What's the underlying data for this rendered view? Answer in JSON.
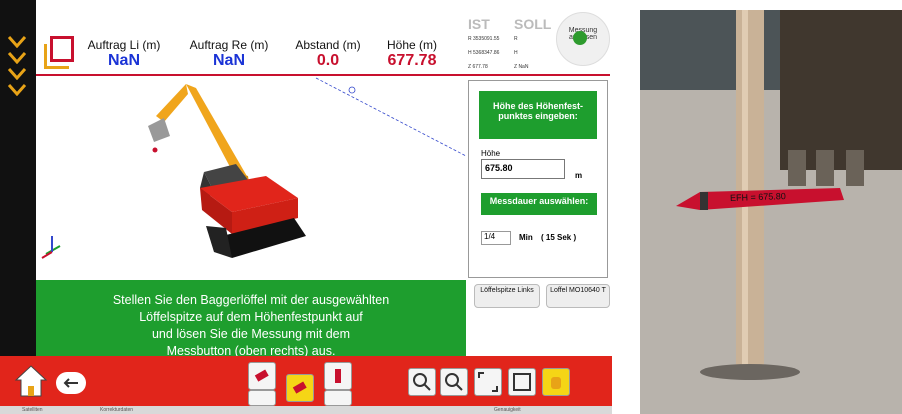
{
  "header": {
    "cols": [
      {
        "label": "Auftrag Li (m)",
        "value": "NaN",
        "color": "#1a33d6"
      },
      {
        "label": "Auftrag Re (m)",
        "value": "NaN",
        "color": "#1a33d6"
      },
      {
        "label": "Abstand (m)",
        "value": "0.0",
        "color": "#c8102e"
      },
      {
        "label": "Höhe (m)",
        "value": "677.78",
        "color": "#c8102e"
      }
    ],
    "ist": "IST",
    "soll": "SOLL",
    "coords": [
      "R 3535091.55",
      "H 5368347.86",
      "Z 677.78"
    ],
    "soll_vals": [
      "R",
      "H",
      "Z NaN"
    ],
    "measure_button": "Messung auslösen"
  },
  "panel": {
    "height_title": "Höhe des Höhenfest-punktes eingeben:",
    "height_label": "Höhe",
    "height_value": "675.80",
    "height_unit": "m",
    "duration_title": "Messdauer auswählen:",
    "duration_value": "1/4",
    "duration_unit": "Min",
    "duration_secs": "( 15 Sek )",
    "spoon_tip_btn": "Löffelspitze Links",
    "spoon_btn": "Loffel MO10640 T"
  },
  "message": [
    "Stellen Sie den Baggerlöffel mit der ausgewählten",
    "Löffelspitze auf dem Höhenfestpunkt auf",
    "und lösen Sie die Messung mit dem",
    "Messbutton (oben rechts) aus."
  ],
  "status": {
    "left": "Satelliten",
    "mid": "Korrekturdaten",
    "right": "Genauigkeit"
  },
  "photo": {
    "sign_text": "EFH = 675.80"
  }
}
